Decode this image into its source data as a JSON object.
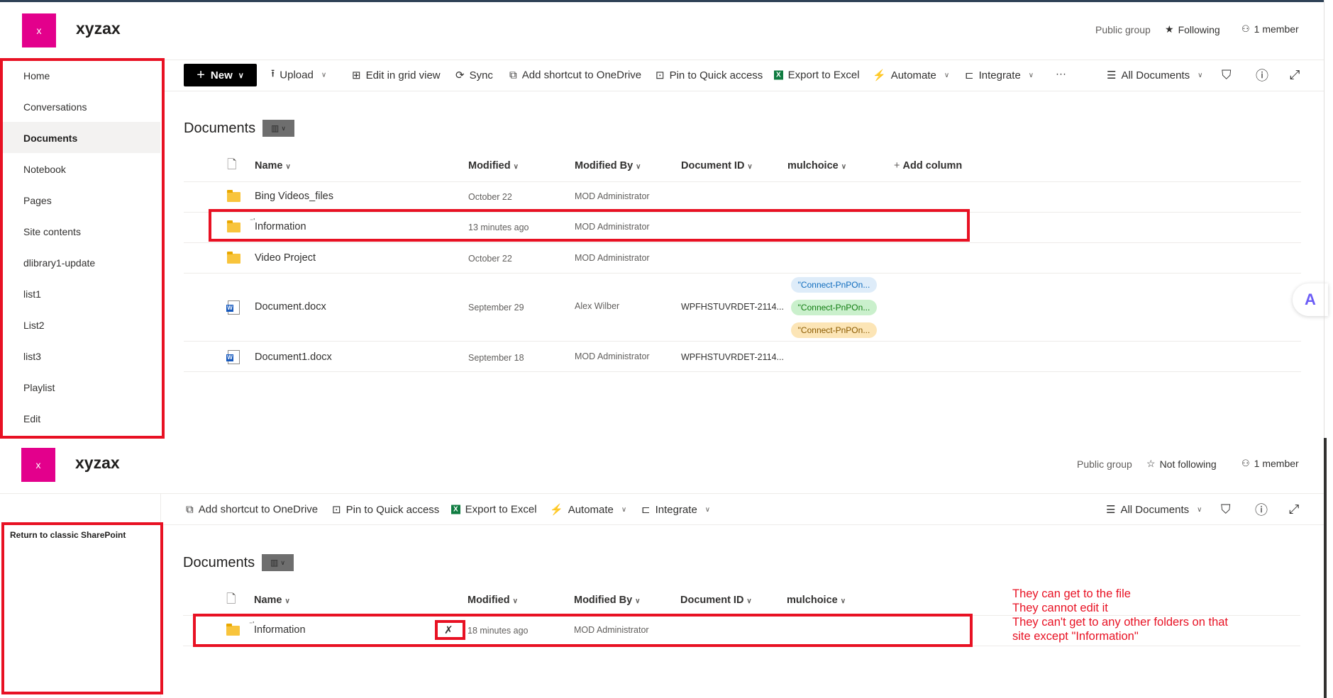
{
  "top": {
    "site_logo_letter": "x",
    "site_title": "xyzax",
    "header": {
      "group_type": "Public group",
      "follow_label": "Following",
      "members": "1 member"
    },
    "nav": [
      "Home",
      "Conversations",
      "Documents",
      "Notebook",
      "Pages",
      "Site contents",
      "dlibrary1-update",
      "list1",
      "List2",
      "list3",
      "Playlist",
      "Edit"
    ],
    "nav_selected": "Documents",
    "commands": {
      "new": "New",
      "upload": "Upload",
      "edit_grid": "Edit in grid view",
      "sync": "Sync",
      "add_shortcut": "Add shortcut to OneDrive",
      "pin": "Pin to Quick access",
      "export": "Export to Excel",
      "automate": "Automate",
      "integrate": "Integrate",
      "more": "···",
      "view": "All Documents"
    },
    "library_title": "Documents",
    "columns": {
      "name": "Name",
      "modified": "Modified",
      "modified_by": "Modified By",
      "document_id": "Document ID",
      "mulchoice": "mulchoice",
      "add_column": "Add column"
    },
    "rows": [
      {
        "name": "Bing Videos_files",
        "modified": "October 22",
        "modified_by": "MOD Administrator",
        "type": "folder"
      },
      {
        "name": "Information",
        "modified": "13 minutes ago",
        "modified_by": "MOD Administrator",
        "type": "folder"
      },
      {
        "name": "Video Project",
        "modified": "October 22",
        "modified_by": "MOD Administrator",
        "type": "folder"
      },
      {
        "name": "Document.docx",
        "modified": "September 29",
        "modified_by": "Alex Wilber",
        "document_id": "WPFHSTUVRDET-2114...",
        "type": "word",
        "mulchoice": [
          "\"Connect-PnPOn...",
          "\"Connect-PnPOn...",
          "\"Connect-PnPOn..."
        ]
      },
      {
        "name": "Document1.docx",
        "modified": "September 18",
        "modified_by": "MOD Administrator",
        "document_id": "WPFHSTUVRDET-2114...",
        "type": "word"
      }
    ]
  },
  "bottom": {
    "site_logo_letter": "x",
    "site_title": "xyzax",
    "header": {
      "group_type": "Public group",
      "follow_label": "Not following",
      "members": "1 member"
    },
    "nav": [
      "Return to classic SharePoint"
    ],
    "commands": {
      "add_shortcut": "Add shortcut to OneDrive",
      "pin": "Pin to Quick access",
      "export": "Export to Excel",
      "automate": "Automate",
      "integrate": "Integrate",
      "view": "All Documents"
    },
    "library_title": "Documents",
    "columns": {
      "name": "Name",
      "modified": "Modified",
      "modified_by": "Modified By",
      "document_id": "Document ID",
      "mulchoice": "mulchoice"
    },
    "rows": [
      {
        "name": "Information",
        "modified": "18 minutes ago",
        "modified_by": "MOD Administrator",
        "type": "folder"
      }
    ]
  },
  "annotation": [
    "They can get to the file",
    "They cannot edit it",
    "They can't get to any other folders on that",
    "site except \"Information\""
  ],
  "colors": {
    "brand": "#e3008c",
    "highlight": "#e81123",
    "chip_blue": "#deecf9",
    "chip_green": "#caf0cc",
    "chip_yellow": "#fce5b6"
  }
}
